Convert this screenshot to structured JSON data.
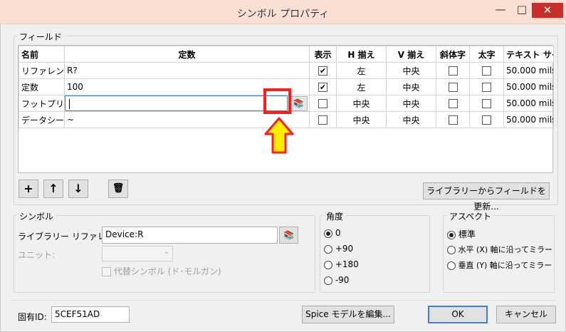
{
  "window": {
    "title": "シンボル プロパティ",
    "minimize": "—",
    "maximize": "□",
    "close": "✕"
  },
  "fields_group": {
    "label": "フィールド",
    "columns": [
      "名前",
      "定数",
      "表示",
      "H 揃え",
      "V 揃え",
      "斜体字",
      "太字",
      "テキスト サイズ"
    ],
    "rows": [
      {
        "name": "リファレンス",
        "value": "R?",
        "show": true,
        "h": "左",
        "v": "中央",
        "italic": false,
        "bold": false,
        "size": "50.000 mils"
      },
      {
        "name": "定数",
        "value": "100",
        "show": true,
        "h": "左",
        "v": "中央",
        "italic": false,
        "bold": false,
        "size": "50.000 mils"
      },
      {
        "name": "フットプリント",
        "value": "",
        "show": false,
        "h": "中央",
        "v": "中央",
        "italic": false,
        "bold": false,
        "size": "50.000 mils"
      },
      {
        "name": "データシート",
        "value": "~",
        "show": false,
        "h": "中央",
        "v": "中央",
        "italic": false,
        "bold": false,
        "size": "50.000 mils"
      }
    ],
    "buttons": {
      "add": "+",
      "up": "↑",
      "down": "↓",
      "delete": "🗑",
      "update": "ライブラリーからフィールドを更新..."
    }
  },
  "symbol_group": {
    "label": "シンボル",
    "lib_ref_label": "ライブラリー リファレンス:",
    "lib_ref_value": "Device:R",
    "unit_label": "ユニット:",
    "alt_symbol_label": "代替シンボル (ド･モルガン)"
  },
  "angle_group": {
    "label": "角度",
    "options": [
      "0",
      "+90",
      "+180",
      "-90"
    ],
    "selected": 0
  },
  "aspect_group": {
    "label": "アスペクト",
    "options": [
      "標準",
      "水平 (X) 軸に沿ってミラー",
      "垂直 (Y) 軸に沿ってミラー"
    ],
    "selected": 0
  },
  "footer": {
    "uid_label": "固有ID:",
    "uid_value": "5CEF51AD",
    "spice_button": "Spice モデルを編集...",
    "ok": "OK",
    "cancel": "キャンセル"
  },
  "colors": {
    "titlebar": "#fae0d4",
    "close": "#c7302a",
    "highlight": "#ff1c1c",
    "arrow": "#ffee00",
    "focus": "#3c7fd1"
  }
}
